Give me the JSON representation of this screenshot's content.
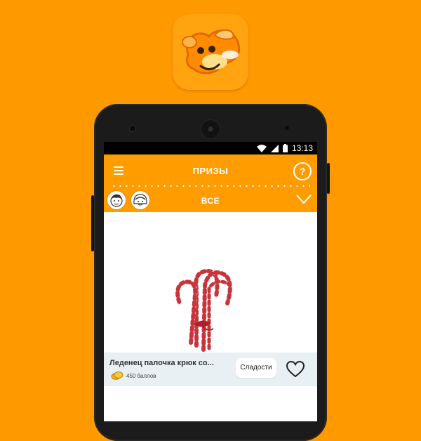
{
  "status_bar": {
    "time": "13:13"
  },
  "app_bar": {
    "title": "ПРИЗЫ",
    "help_label": "?"
  },
  "filter_bar": {
    "selected": "ВСЕ"
  },
  "products": [
    {
      "name": "Леденец палочка крюк со...",
      "points": "450 баллов",
      "category": "Сладости",
      "image_icon": "candy-cane-image"
    },
    {
      "image_icon": "lollipop-image"
    }
  ],
  "colors": {
    "background": "#FF9900",
    "appbar": "#FF9C00",
    "info_bg": "#E8F0F3"
  },
  "icons": [
    "app-mascot-icon",
    "wifi-icon",
    "signal-icon",
    "battery-icon",
    "menu-icon",
    "help-icon",
    "boy-avatar-icon",
    "girl-avatar-icon",
    "chevron-down-icon",
    "coin-icon",
    "heart-icon"
  ]
}
